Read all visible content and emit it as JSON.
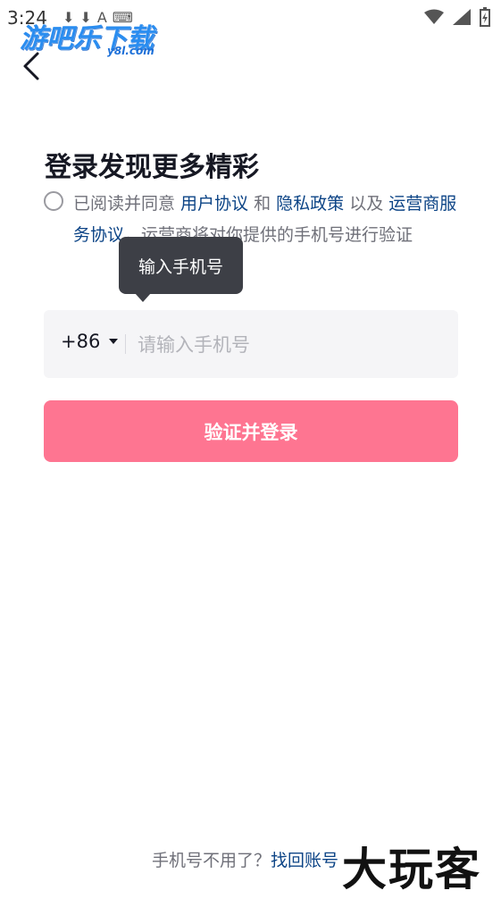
{
  "status_bar": {
    "time": "3:24",
    "icons": [
      "download-icon",
      "download-icon",
      "a-icon",
      "keyboard-icon"
    ],
    "right_icons": [
      "wifi-icon",
      "signal-icon",
      "battery-icon"
    ]
  },
  "watermark": {
    "logo_text": "游吧乐下载",
    "logo_sub": "y8l.com",
    "corner_text": "大玩客"
  },
  "login": {
    "title": "登录发现更多精彩",
    "agreement": {
      "prefix": "已阅读并同意 ",
      "user_agreement": "用户协议",
      "and": " 和 ",
      "privacy_policy": "隐私政策",
      "and2": " 以及 ",
      "operator_terms": "运营商服务协议",
      "suffix": "，运营商将对你提供的手机号进行验证"
    },
    "tooltip": "输入手机号",
    "country_code": "+86",
    "phone_placeholder": "请输入手机号",
    "submit_label": "验证并登录"
  },
  "footer": {
    "text": "手机号不用了？",
    "link": "找回账号"
  },
  "colors": {
    "accent": "#fe7591",
    "link": "#0c4486"
  }
}
